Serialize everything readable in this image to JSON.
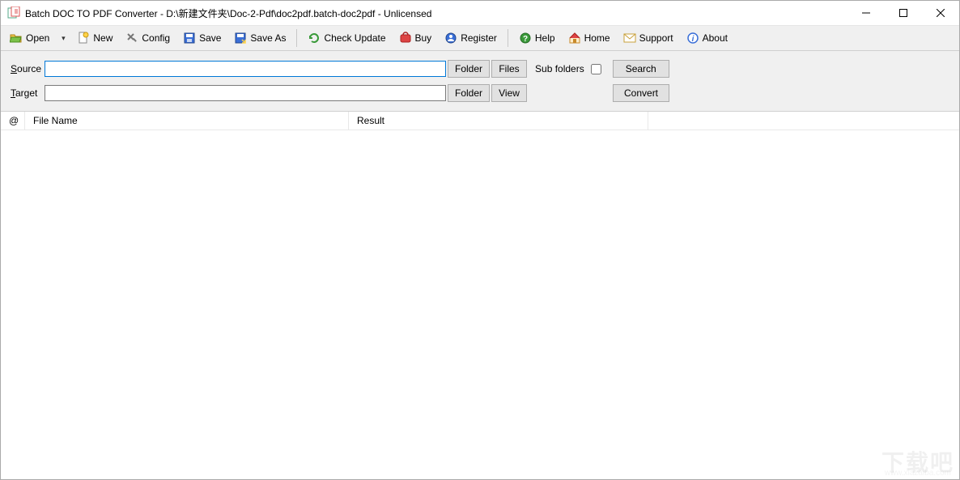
{
  "titlebar": {
    "title": "Batch DOC TO PDF Converter - D:\\新建文件夹\\Doc-2-Pdf\\doc2pdf.batch-doc2pdf - Unlicensed"
  },
  "toolbar": {
    "open": "Open",
    "new": "New",
    "config": "Config",
    "save": "Save",
    "save_as": "Save As",
    "check_update": "Check Update",
    "buy": "Buy",
    "register": "Register",
    "help": "Help",
    "home": "Home",
    "support": "Support",
    "about": "About"
  },
  "form": {
    "source_label_pre": "S",
    "source_label_rest": "ource",
    "target_label_pre": "T",
    "target_label_rest": "arget",
    "source_value": "",
    "target_value": "",
    "folder_btn": "Folder",
    "files_btn": "Files",
    "view_btn": "View",
    "subfolders_label": "Sub folders",
    "subfolders_checked": false,
    "search_btn": "Search",
    "convert_btn": "Convert"
  },
  "columns": {
    "at": "@",
    "file_name": "File Name",
    "result": "Result"
  },
  "rows": [],
  "watermark": {
    "main": "下载吧",
    "sub": "www.xiazaiba.com"
  }
}
